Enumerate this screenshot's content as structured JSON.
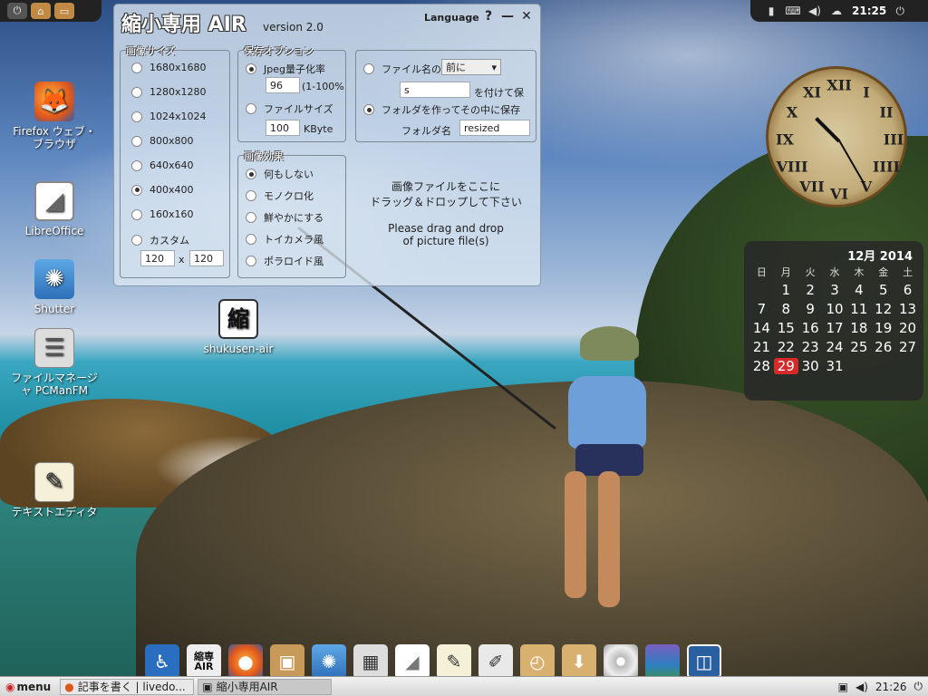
{
  "top_left_panel": {
    "items": [
      {
        "icon": "home-icon"
      },
      {
        "icon": "folder-icon"
      },
      {
        "icon": "window-icon"
      }
    ]
  },
  "top_right_panel": {
    "time": "21:25"
  },
  "desktop_icons": [
    {
      "label": "Firefox ウェブ・ブラウザ",
      "icon": "firefox-icon"
    },
    {
      "label": "LibreOffice",
      "icon": "libreoffice-icon"
    },
    {
      "label": "Shutter",
      "icon": "shutter-icon"
    },
    {
      "label": "ファイルマネージャ PCManFM",
      "icon": "file-manager-icon"
    },
    {
      "label": "テキストエディタ",
      "icon": "text-editor-icon"
    },
    {
      "label": "shukusen-air",
      "icon": "shukusen-icon"
    }
  ],
  "app": {
    "title": "縮小専用 AIR",
    "version": "version 2.0",
    "language": "Language",
    "help": "?",
    "minimize": "—",
    "close": "✕",
    "size_group": {
      "label": "画像サイズ",
      "options": [
        "1680x1680",
        "1280x1280",
        "1024x1024",
        "800x800",
        "640x640",
        "400x400",
        "160x160",
        "カスタム"
      ],
      "custom_w": "120",
      "custom_x": "x",
      "custom_h": "120"
    },
    "save_group": {
      "label": "保存オプション",
      "jpeg_label": "Jpeg量子化率",
      "jpeg_value": "96",
      "jpeg_range": "(1-100%",
      "filesize_label": "ファイルサイズ",
      "filesize_value": "100",
      "filesize_unit": "KByte"
    },
    "effect_group": {
      "label": "画像効果",
      "options": [
        "何もしない",
        "モノクロ化",
        "鮮やかにする",
        "トイカメラ風",
        "ポラロイド風"
      ]
    },
    "name_group": {
      "filename_label": "ファイル名の",
      "position_value": "前に",
      "suffix_value": "s",
      "suffix_label": "を付けて保",
      "folder_label": "フォルダを作ってその中に保存",
      "folder_name_label": "フォルダ名",
      "folder_name_value": "resized"
    },
    "drop_ja_1": "画像ファイルをここに",
    "drop_ja_2": "ドラッグ＆ドロップして下さい",
    "drop_en_1": "Please drag and drop",
    "drop_en_2": "of picture file(s)"
  },
  "clock": {
    "numerals": [
      "XII",
      "I",
      "II",
      "III",
      "IIII",
      "V",
      "VI",
      "VII",
      "VIII",
      "IX",
      "X",
      "XI"
    ],
    "time": "21:25"
  },
  "calendar": {
    "month": "12月 2014",
    "weekdays": [
      "日",
      "月",
      "火",
      "水",
      "木",
      "金",
      "土"
    ],
    "days": [
      "",
      "1",
      "2",
      "3",
      "4",
      "5",
      "6",
      "7",
      "8",
      "9",
      "10",
      "11",
      "12",
      "13",
      "14",
      "15",
      "16",
      "17",
      "18",
      "19",
      "20",
      "21",
      "22",
      "23",
      "24",
      "25",
      "26",
      "27",
      "28",
      "29",
      "30",
      "31",
      "",
      "",
      ""
    ],
    "today": "29"
  },
  "dock": {
    "items": [
      {
        "icon": "accessibility-icon"
      },
      {
        "icon": "shukusen-air-icon",
        "label": "縮専 AIR"
      },
      {
        "icon": "firefox-icon"
      },
      {
        "icon": "package-installer-icon"
      },
      {
        "icon": "shutter-icon"
      },
      {
        "icon": "calculator-icon"
      },
      {
        "icon": "libreoffice-icon"
      },
      {
        "icon": "text-editor-icon"
      },
      {
        "icon": "notepad-icon"
      },
      {
        "icon": "clock-icon"
      },
      {
        "icon": "download-icon"
      },
      {
        "icon": "disc-icon"
      },
      {
        "icon": "wallpaper-icon"
      },
      {
        "icon": "workspace-icon"
      }
    ]
  },
  "taskbar": {
    "menu": "menu",
    "tasks": [
      {
        "label": "記事を書く | livedo...",
        "icon": "firefox-icon"
      },
      {
        "label": "縮小専用AIR",
        "icon": "app-icon"
      }
    ],
    "time": "21:26"
  }
}
